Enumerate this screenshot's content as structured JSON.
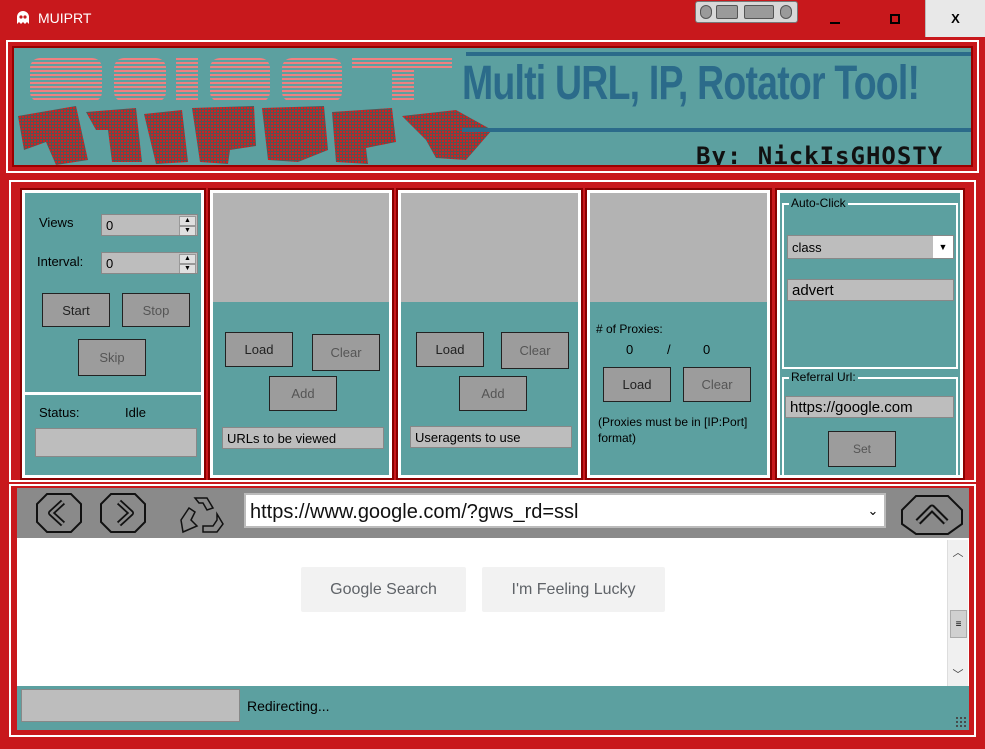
{
  "window": {
    "title": "MUIPRT",
    "minimize_icon": "minimize-icon",
    "maximize_icon": "maximize-icon",
    "close_label": "X"
  },
  "banner": {
    "logo_text": "MUIPRT",
    "title": "Multi URL, IP, Rotator Tool!",
    "byline": "By: NickIsGHOSTY"
  },
  "views_panel": {
    "views_label": "Views",
    "views_value": "0",
    "interval_label": "Interval:",
    "interval_value": "0",
    "start_label": "Start",
    "stop_label": "Stop",
    "skip_label": "Skip",
    "status_label": "Status:",
    "status_value": "Idle",
    "status_field_value": ""
  },
  "urls_panel": {
    "load_label": "Load",
    "clear_label": "Clear",
    "add_label": "Add",
    "input_value": "URLs to be viewed"
  },
  "useragents_panel": {
    "load_label": "Load",
    "clear_label": "Clear",
    "add_label": "Add",
    "input_value": "Useragents to use"
  },
  "proxies_panel": {
    "count_label": "# of Proxies:",
    "current": "0",
    "separator": "/",
    "total": "0",
    "load_label": "Load",
    "clear_label": "Clear",
    "note": "(Proxies must be in [IP:Port] format)"
  },
  "autoclick_panel": {
    "group_label": "Auto-Click",
    "select_value": "class",
    "input_value": "advert",
    "referral_label": "Referral Url:",
    "referral_value": "https://google.com",
    "set_label": "Set"
  },
  "browser": {
    "back_icon": "back-arrow-icon",
    "forward_icon": "forward-arrow-icon",
    "refresh_icon": "recycle-refresh-icon",
    "home_icon": "home-arrow-icon",
    "url_value": "https://www.google.com/?gws_rd=ssl",
    "google_search_label": "Google Search",
    "lucky_label": "I'm Feeling Lucky",
    "status_text": "Redirecting..."
  },
  "colors": {
    "frame_red": "#c8181c",
    "panel_teal": "#5ca0a0",
    "button_gray": "#9c9c9c",
    "banner_blue": "#2b6b8a"
  }
}
